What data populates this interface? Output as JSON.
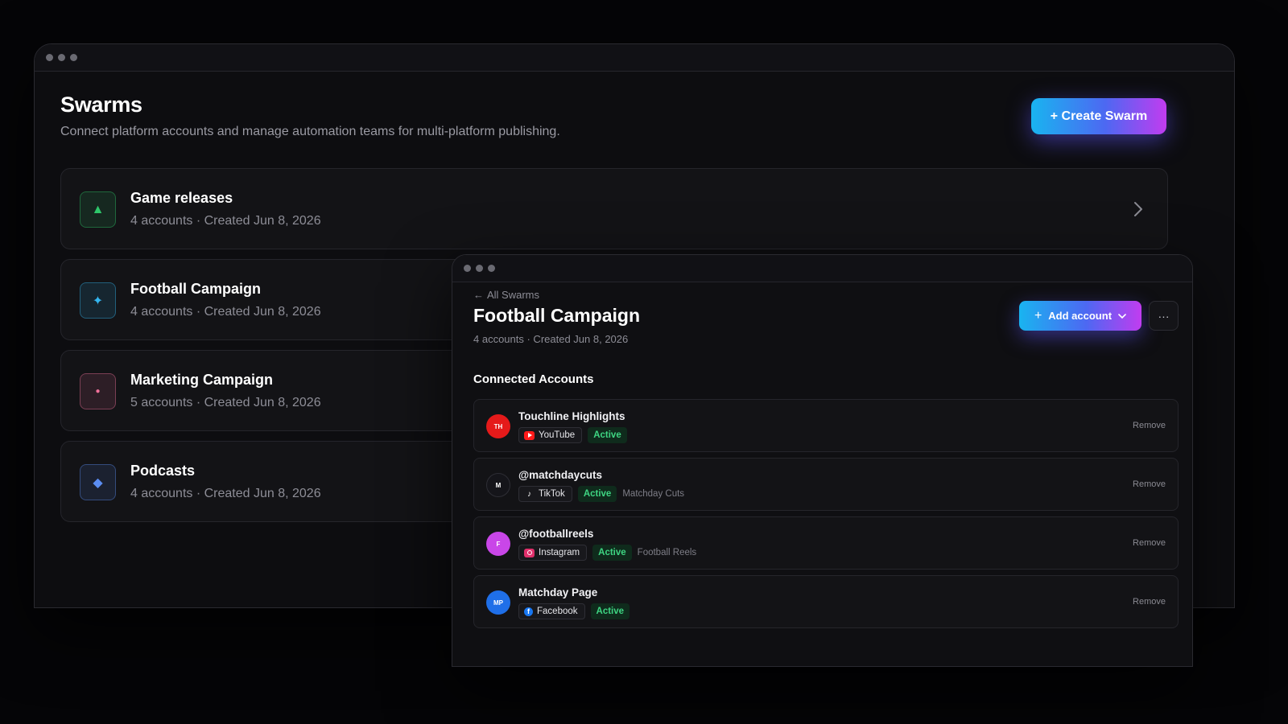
{
  "main": {
    "title": "Swarms",
    "subtitle": "Connect platform accounts and manage automation teams for multi-platform publishing.",
    "create_label": "+ Create Swarm",
    "swarms": [
      {
        "name": "Game releases",
        "meta": "4 accounts · Created Jun 8, 2026",
        "icon": "triangle-icon",
        "glyph": "▲",
        "color": "#2ec76a"
      },
      {
        "name": "Football Campaign",
        "meta": "4 accounts · Created Jun 8, 2026",
        "icon": "sparkle-icon",
        "glyph": "✦",
        "color": "#34b6f0"
      },
      {
        "name": "Marketing Campaign",
        "meta": "5 accounts · Created Jun 8, 2026",
        "icon": "dot-icon",
        "glyph": "●",
        "color": "#f0709a"
      },
      {
        "name": "Podcasts",
        "meta": "4 accounts · Created Jun 8, 2026",
        "icon": "diamond-icon",
        "glyph": "◆",
        "color": "#5b8df2"
      }
    ]
  },
  "detail": {
    "back_label": "All Swarms",
    "title": "Football Campaign",
    "meta": "4 accounts · Created Jun 8, 2026",
    "add_label": "Add account",
    "more_label": "···",
    "section_title": "Connected Accounts",
    "remove_label": "Remove",
    "accounts": [
      {
        "initials": "TH",
        "avatar_color": "#e51a1a",
        "name": "Touchline Highlights",
        "platform": "YouTube",
        "platform_icon": "youtube-icon",
        "platform_color": "#ff1a1a",
        "status": "Active",
        "handle": ""
      },
      {
        "initials": "M",
        "avatar_color": "#15151a",
        "name": "@matchdaycuts",
        "platform": "TikTok",
        "platform_icon": "tiktok-icon",
        "platform_color": "#111114",
        "status": "Active",
        "handle": "Matchday Cuts"
      },
      {
        "initials": "F",
        "avatar_color": "#c946e8",
        "name": "@footballreels",
        "platform": "Instagram",
        "platform_icon": "instagram-icon",
        "platform_color": "#e1306c",
        "status": "Active",
        "handle": "Football Reels"
      },
      {
        "initials": "MP",
        "avatar_color": "#1f6fe8",
        "name": "Matchday Page",
        "platform": "Facebook",
        "platform_icon": "facebook-icon",
        "platform_color": "#1877f2",
        "status": "Active",
        "handle": ""
      }
    ]
  }
}
